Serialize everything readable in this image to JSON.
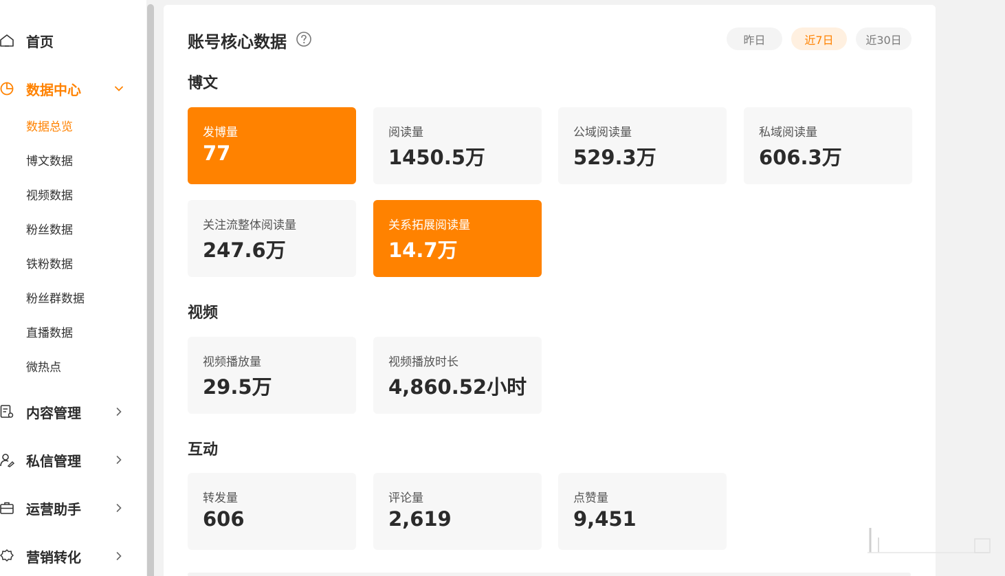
{
  "sidebar": {
    "items": [
      {
        "label": "首页",
        "icon": "home-icon"
      },
      {
        "label": "数据中心",
        "icon": "pie-chart-icon",
        "active": true,
        "expanded": true,
        "children": [
          "数据总览",
          "博文数据",
          "视频数据",
          "粉丝数据",
          "铁粉数据",
          "粉丝群数据",
          "直播数据",
          "微热点"
        ]
      },
      {
        "label": "内容管理",
        "icon": "document-settings-icon"
      },
      {
        "label": "私信管理",
        "icon": "user-edit-icon"
      },
      {
        "label": "运营助手",
        "icon": "briefcase-icon"
      },
      {
        "label": "营销转化",
        "icon": "gear-icon"
      }
    ]
  },
  "header": {
    "title": "账号核心数据",
    "ranges": [
      "昨日",
      "近7日",
      "近30日"
    ],
    "active_range": "近7日"
  },
  "sections": {
    "weibo": {
      "title": "博文",
      "cards": [
        {
          "label": "发博量",
          "value": "77"
        },
        {
          "label": "阅读量",
          "value": "1450.5万"
        },
        {
          "label": "公域阅读量",
          "value": "529.3万"
        },
        {
          "label": "私域阅读量",
          "value": "606.3万"
        },
        {
          "label": "关注流整体阅读量",
          "value": "247.6万"
        },
        {
          "label": "关系拓展阅读量",
          "value": "14.7万"
        }
      ]
    },
    "video": {
      "title": "视频",
      "cards": [
        {
          "label": "视频播放量",
          "value": "29.5万"
        },
        {
          "label": "视频播放时长",
          "value": "4,860.52小时"
        }
      ]
    },
    "interaction": {
      "title": "互动",
      "cards": [
        {
          "label": "转发量",
          "value": "606"
        },
        {
          "label": "评论量",
          "value": "2,619"
        },
        {
          "label": "点赞量",
          "value": "9,451"
        }
      ]
    }
  },
  "colors": {
    "accent": "#ff8200",
    "accent_light": "#fff0e0",
    "card_bg": "#f7f7f7",
    "page_bg": "#f2f2f2"
  }
}
